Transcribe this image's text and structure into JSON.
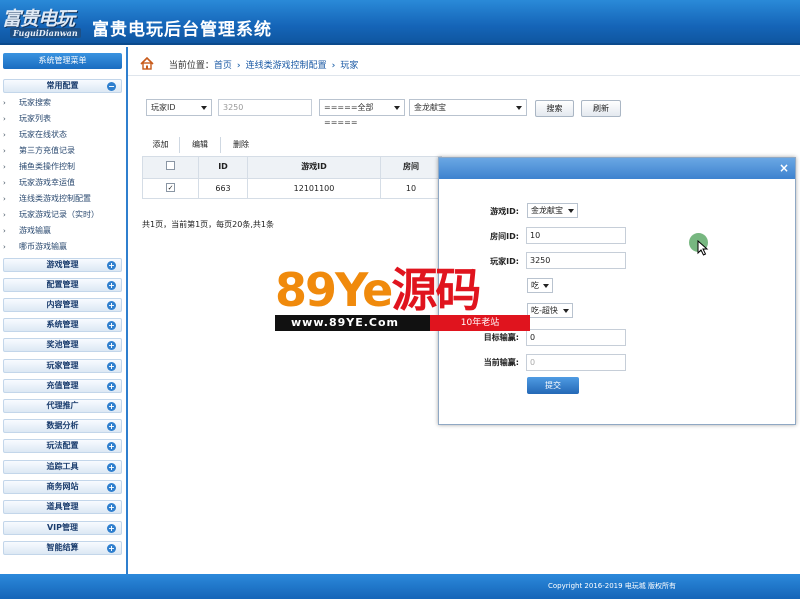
{
  "header": {
    "logo_cn": "富贵电玩",
    "logo_en": "FuguiDianwan",
    "title": "富贵电玩后台管理系统"
  },
  "sidebar": {
    "menu_title": "系统管理菜单",
    "active_group": "常用配置",
    "active_items": [
      "玩家搜索",
      "玩家列表",
      "玩家在线状态",
      "第三方充值记录",
      "捕鱼类操作控制",
      "玩家游戏幸运值",
      "连线类游戏控制配置",
      "玩家游戏记录（实时）",
      "游戏输赢",
      "哪币游戏输赢"
    ],
    "groups": [
      "游戏管理",
      "配置管理",
      "内容管理",
      "系统管理",
      "奖池管理",
      "玩家管理",
      "充值管理",
      "代理推广",
      "数据分析",
      "玩法配置",
      "追踪工具",
      "商务网站",
      "道具管理",
      "VIP管理",
      "智能结算"
    ]
  },
  "breadcrumb": {
    "prefix": "当前位置：",
    "items": [
      "首页",
      "连线类游戏控制配置",
      "玩家"
    ]
  },
  "search": {
    "field_select": "玩家ID",
    "input_value": "3250",
    "type_select": "=====全部=====",
    "game_select": "金龙献宝",
    "search_btn": "搜索",
    "refresh_btn": "刷新"
  },
  "toolbar": {
    "add": "添加",
    "edit": "编辑",
    "delete": "删除"
  },
  "table": {
    "headers": [
      "ID",
      "游戏ID",
      "房间"
    ],
    "row": {
      "id": "663",
      "game_id": "12101100",
      "room": "10"
    }
  },
  "paging": "共1页，当前第1页，每页20条,共1条",
  "modal": {
    "close": "×",
    "game_label": "游戏ID:",
    "game_value": "金龙献宝",
    "room_label": "房间ID:",
    "room_value": "10",
    "player_label": "玩家ID:",
    "player_value": "3250",
    "mode_value": "吃",
    "speed_value": "吃-超快",
    "target_label": "目标输赢:",
    "target_value": "0",
    "current_label": "当前输赢:",
    "current_value": "0",
    "submit": "提交"
  },
  "watermark": {
    "big_prefix": "89",
    "big_ye": "Ye",
    "big_cn": "源码",
    "url": "www.89YE.Com",
    "tag": "10年老站"
  },
  "footer": {
    "copyright": "Copyright 2016-2019 电玩城 版权所有"
  }
}
